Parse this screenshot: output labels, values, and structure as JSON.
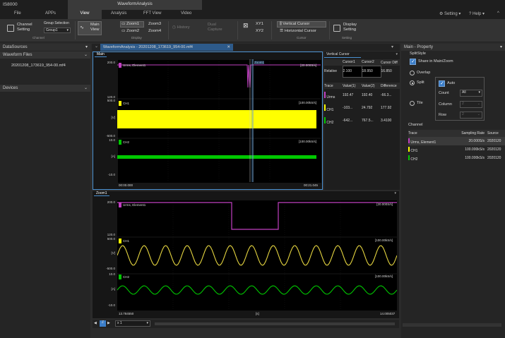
{
  "app": {
    "name": "IS8000",
    "context_title": "WaveformAnalysis"
  },
  "tabs": [
    "File",
    "APPs",
    "View",
    "Analysis",
    "FFT View",
    "Video"
  ],
  "top_right": {
    "setting": "Setting",
    "help": "Help"
  },
  "ribbon": {
    "channel_setting": "Channel\nSetting",
    "group_selection_label": "Group Selection",
    "group_value": "Group1",
    "channel_group": "Channel",
    "main_view": "Main\nView",
    "zoom1": "Zoom1",
    "zoom2": "Zoom2",
    "zoom3": "Zoom3",
    "zoom4": "Zoom4",
    "display_group": "Display",
    "history": "History",
    "dual_capture": "Dual\nCapture",
    "xy1": "XY1",
    "xy2": "XY2",
    "vertical_cursor": "Vertical Cursor",
    "horizontal_cursor": "Horizontal Cursor",
    "cursor_group": "Cursor",
    "display_setting": "Display\nSetting",
    "setting_group": "Setting"
  },
  "left": {
    "datasources": "DataSources",
    "waveform_files": "Waveform Files",
    "file": "20201208_173619_954-00.mf4",
    "devices": "Devices"
  },
  "doc_tab": "WaveformAnalysis - 20201208_173619_954-00.mf4",
  "main_view": {
    "title": "Main",
    "zoom_marker": "Zoom1",
    "traces": [
      {
        "name": "Urms, Element1",
        "rate": "[20.000S/s]",
        "top": "200.0",
        "unit": "",
        "bottom": "120.0",
        "color": "#c040c0"
      },
      {
        "name": "CH1",
        "rate": "[100.00kS/s]",
        "top": "500.0",
        "unit": "[V]",
        "bottom": "-500.0",
        "color": "#ffff00"
      },
      {
        "name": "CH2",
        "rate": "[100.00kS/s]",
        "top": "10.0",
        "unit": "[A]",
        "bottom": "-10.0",
        "color": "#00c800"
      }
    ],
    "x_start": "00:00.000",
    "x_end": "00:21.045"
  },
  "cursor_panel": {
    "title": "Vertical Cursor",
    "headers": [
      "",
      "Cursor1",
      "Cursor2",
      "Cursor Diff"
    ],
    "relative": [
      "Relative",
      "2.100",
      "18.950",
      "16.850"
    ],
    "sub_headers": [
      "Trace",
      "Value(1)",
      "Value(2)",
      "Difference"
    ],
    "rows": [
      {
        "name": "Urms",
        "v1": "192.47",
        "v2": "192.40",
        "diff": "-66.3...",
        "color": "#c040c0"
      },
      {
        "name": "CH1",
        "v1": "-103...",
        "v2": "24.792",
        "diff": "177.92",
        "color": "#ffff00"
      },
      {
        "name": "CH2",
        "v1": "-642...",
        "v2": "767.5...",
        "diff": "3.4100",
        "color": "#00c800"
      }
    ]
  },
  "zoom_view": {
    "title": "Zoom1",
    "traces": [
      {
        "name": "Urms, Element1",
        "rate": "[20.000S/s]",
        "top": "200.0",
        "unit": "",
        "bottom": "120.0"
      },
      {
        "name": "CH1",
        "rate": "[100.00kS/s]",
        "top": "500.0",
        "unit": "[V]",
        "bottom": "-500.0"
      },
      {
        "name": "CH2",
        "rate": "[100.00kS/s]",
        "top": "10.0",
        "unit": "[A]",
        "bottom": "-10.0"
      }
    ],
    "x_start": "13.784550",
    "x_mid": "[s]",
    "x_end": "14.005037"
  },
  "bottom_bar": {
    "zoom_factor": "x 1"
  },
  "properties": {
    "title": "Main - Property",
    "splitstyle": "SplitStyle",
    "share": "Share in Main/Zoom",
    "overlap": "Overlap",
    "split": "Split",
    "tile": "Tile",
    "auto": "Auto",
    "count": "Count",
    "count_value": "All",
    "column": "Column",
    "column_value": "2",
    "row": "Row",
    "row_value": "2",
    "channel": "Channel",
    "ch_headers": [
      "Trace",
      "Sampling Rate",
      "Source"
    ],
    "ch_rows": [
      {
        "name": "Urms, Element1",
        "rate": "20.000S/s",
        "src": "2020120",
        "color": "#c040c0"
      },
      {
        "name": "CH1",
        "rate": "100.000kS/s",
        "src": "2020120",
        "color": "#ffff00"
      },
      {
        "name": "CH2",
        "rate": "100.000kS/s",
        "src": "2020120",
        "color": "#00c800"
      }
    ]
  }
}
